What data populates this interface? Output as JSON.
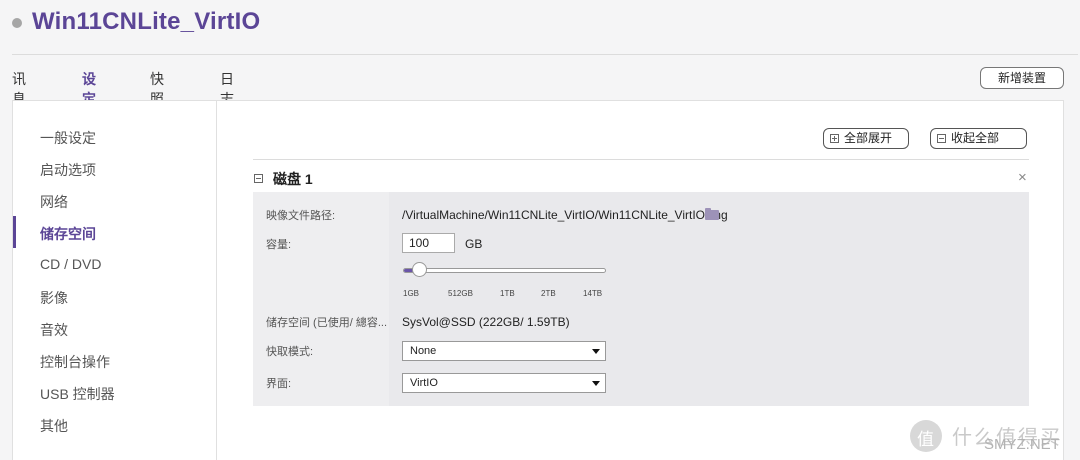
{
  "window": {
    "vm_title": "Win11CNLite_VirtIO"
  },
  "tabs": [
    {
      "label": "讯息"
    },
    {
      "label": "设定",
      "active": true
    },
    {
      "label": "快照"
    },
    {
      "label": "日志"
    }
  ],
  "toolbar": {
    "add_device_label": "新增装置"
  },
  "sidebar": {
    "items": [
      {
        "label": "一般设定"
      },
      {
        "label": "启动选项"
      },
      {
        "label": "网络"
      },
      {
        "label": "储存空间",
        "active": true
      },
      {
        "label": "CD / DVD"
      },
      {
        "label": "影像"
      },
      {
        "label": "音效"
      },
      {
        "label": "控制台操作"
      },
      {
        "label": "USB 控制器"
      },
      {
        "label": "其他"
      }
    ]
  },
  "content": {
    "expand_all_label": "全部展开",
    "collapse_all_label": "收起全部",
    "disk": {
      "title": "磁盘 1",
      "close_symbol": "×",
      "path_label": "映像文件路径:",
      "path_value": "/VirtualMachine/Win11CNLite_VirtIO/Win11CNLite_VirtIO.img",
      "capacity_label": "容量:",
      "capacity_value": "100",
      "capacity_unit": "GB",
      "slider_ticks": [
        "1GB",
        "512GB",
        "1TB",
        "2TB",
        "14TB"
      ],
      "slider_fraction": 0.08,
      "storage_label": "储存空间 (已使用/ 總容...",
      "storage_value": "SysVol@SSD (222GB/ 1.59TB)",
      "cache_label": "快取模式:",
      "cache_value": "None",
      "interface_label": "界面:",
      "interface_value": "VirtIO"
    }
  },
  "watermark": {
    "logo_char": "值",
    "brand_text": "什么值得买",
    "url_text": "SMYZ.NET"
  },
  "colors": {
    "accent": "#5b4596",
    "slider_fill": "#6a55a8"
  }
}
